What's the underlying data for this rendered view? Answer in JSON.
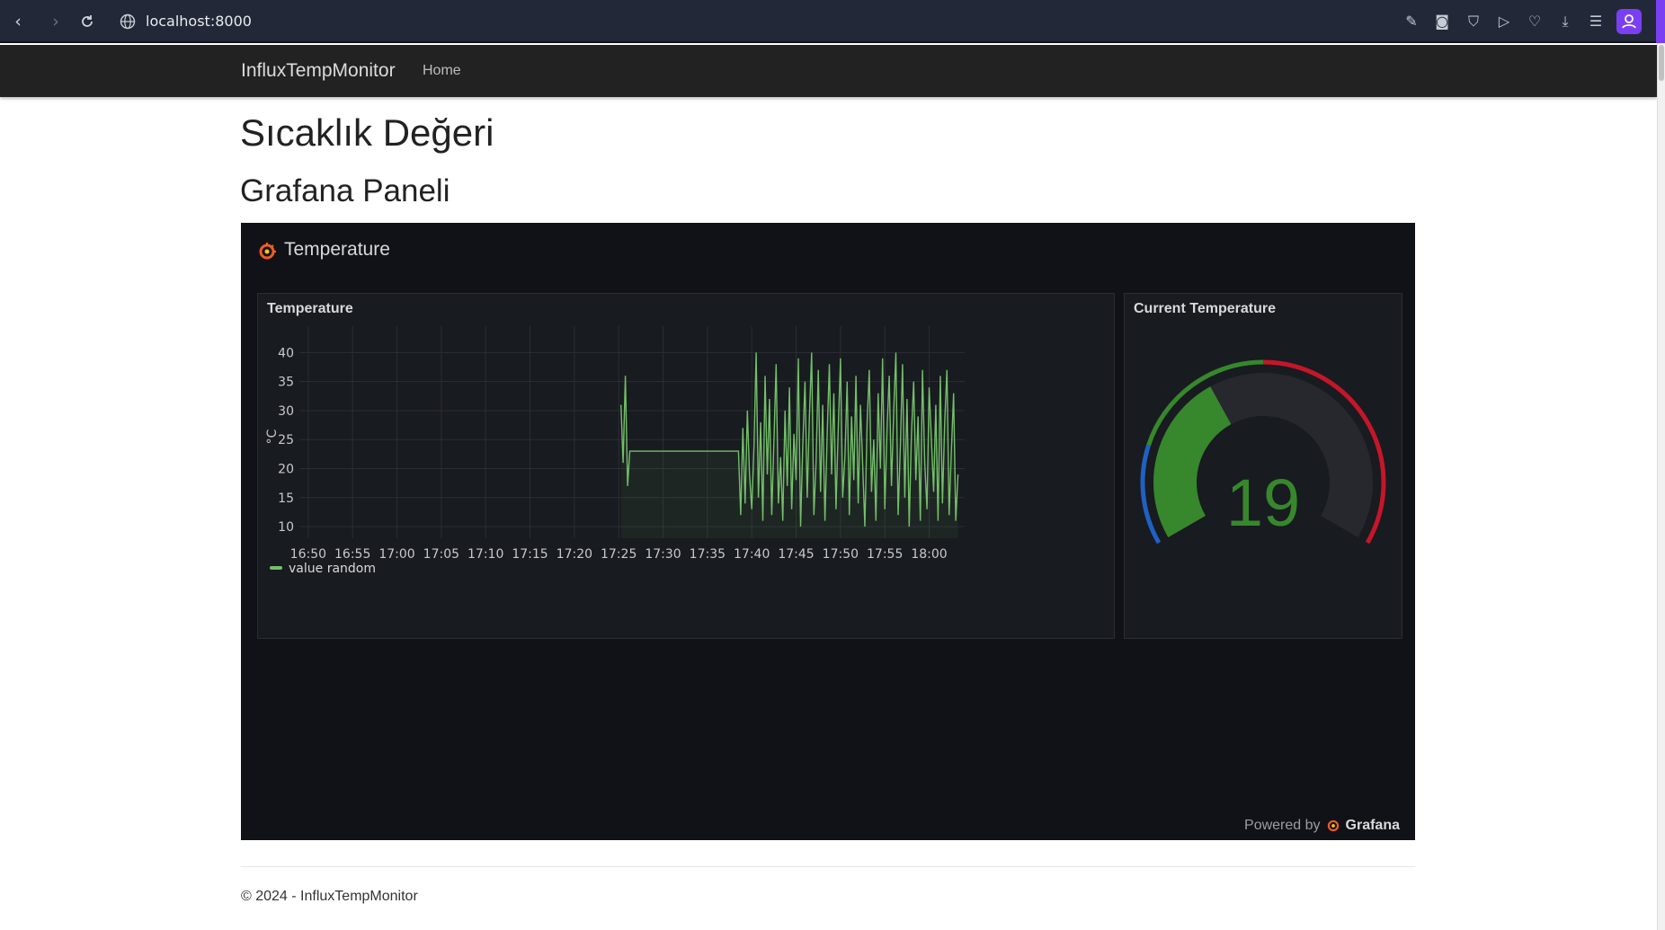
{
  "browser": {
    "url": "localhost:8000",
    "back_icon": "chevron-left-icon",
    "forward_icon": "chevron-right-icon",
    "reload_icon": "reload-icon"
  },
  "navbar": {
    "brand": "InfluxTempMonitor",
    "links": [
      "Home"
    ]
  },
  "page": {
    "title": "Sıcaklık Değeri",
    "subtitle": "Grafana Paneli"
  },
  "dashboard": {
    "title": "Temperature",
    "powered_by": "Powered by",
    "grafana_name": "Grafana",
    "panels": {
      "timeseries": {
        "title": "Temperature",
        "legend": "value random",
        "y_unit_label": "°C"
      },
      "gauge": {
        "title": "Current Temperature",
        "value": "19"
      }
    }
  },
  "colors": {
    "series": "#73bf69",
    "gauge_green": "#37872d",
    "gauge_blue": "#1f60c4",
    "gauge_red": "#c4162a",
    "panel_bg": "#181b1f",
    "dash_bg": "#111217"
  },
  "footer": {
    "text": "© 2024 - InfluxTempMonitor"
  },
  "chart_data": {
    "type": "line",
    "title": "Temperature",
    "ylabel": "°C",
    "ylim": [
      8,
      43
    ],
    "yticks": [
      "10",
      "15",
      "20",
      "25",
      "30",
      "35",
      "40"
    ],
    "xticks": [
      "16:50",
      "16:55",
      "17:00",
      "17:05",
      "17:10",
      "17:15",
      "17:20",
      "17:25",
      "17:30",
      "17:35",
      "17:40",
      "17:45",
      "17:50",
      "17:55",
      "18:00"
    ],
    "series": [
      {
        "name": "value random",
        "points": [
          [
            "17:25:15",
            31
          ],
          [
            "17:25:30",
            21
          ],
          [
            "17:25:45",
            36
          ],
          [
            "17:26:00",
            17
          ],
          [
            "17:26:15",
            23
          ],
          [
            "17:38:30",
            23
          ],
          [
            "17:38:45",
            12
          ],
          [
            "17:39:00",
            27
          ],
          [
            "17:39:15",
            14
          ],
          [
            "17:39:30",
            30
          ],
          [
            "17:39:45",
            19
          ],
          [
            "17:40:00",
            13
          ],
          [
            "17:40:15",
            24
          ],
          [
            "17:40:30",
            40
          ],
          [
            "17:40:45",
            15
          ],
          [
            "17:41:00",
            28
          ],
          [
            "17:41:15",
            11
          ],
          [
            "17:41:30",
            36
          ],
          [
            "17:41:45",
            19
          ],
          [
            "17:42:00",
            32
          ],
          [
            "17:42:15",
            12
          ],
          [
            "17:42:30",
            25
          ],
          [
            "17:42:45",
            38
          ],
          [
            "17:43:00",
            14
          ],
          [
            "17:43:15",
            22
          ],
          [
            "17:43:30",
            11
          ],
          [
            "17:43:45",
            30
          ],
          [
            "17:44:00",
            17
          ],
          [
            "17:44:15",
            34
          ],
          [
            "17:44:30",
            13
          ],
          [
            "17:44:45",
            26
          ],
          [
            "17:45:00",
            18
          ],
          [
            "17:45:15",
            39
          ],
          [
            "17:45:30",
            10
          ],
          [
            "17:45:45",
            24
          ],
          [
            "17:46:00",
            35
          ],
          [
            "17:46:15",
            15
          ],
          [
            "17:46:30",
            29
          ],
          [
            "17:46:45",
            40
          ],
          [
            "17:47:00",
            12
          ],
          [
            "17:47:15",
            21
          ],
          [
            "17:47:30",
            37
          ],
          [
            "17:47:45",
            16
          ],
          [
            "17:48:00",
            31
          ],
          [
            "17:48:15",
            11
          ],
          [
            "17:48:30",
            26
          ],
          [
            "17:48:45",
            38
          ],
          [
            "17:49:00",
            19
          ],
          [
            "17:49:15",
            33
          ],
          [
            "17:49:30",
            13
          ],
          [
            "17:49:45",
            27
          ],
          [
            "17:50:00",
            39
          ],
          [
            "17:50:15",
            15
          ],
          [
            "17:50:30",
            22
          ],
          [
            "17:50:45",
            35
          ],
          [
            "17:51:00",
            12
          ],
          [
            "17:51:15",
            29
          ],
          [
            "17:51:30",
            18
          ],
          [
            "17:51:45",
            36
          ],
          [
            "17:52:00",
            14
          ],
          [
            "17:52:15",
            31
          ],
          [
            "17:52:30",
            21
          ],
          [
            "17:52:45",
            10
          ],
          [
            "17:53:00",
            28
          ],
          [
            "17:53:15",
            37
          ],
          [
            "17:53:30",
            16
          ],
          [
            "17:53:45",
            25
          ],
          [
            "17:54:00",
            11
          ],
          [
            "17:54:15",
            33
          ],
          [
            "17:54:30",
            20
          ],
          [
            "17:54:45",
            39
          ],
          [
            "17:55:00",
            13
          ],
          [
            "17:55:15",
            27
          ],
          [
            "17:55:30",
            36
          ],
          [
            "17:55:45",
            17
          ],
          [
            "17:56:00",
            30
          ],
          [
            "17:56:15",
            40
          ],
          [
            "17:56:30",
            12
          ],
          [
            "17:56:45",
            24
          ],
          [
            "17:57:00",
            38
          ],
          [
            "17:57:15",
            15
          ],
          [
            "17:57:30",
            32
          ],
          [
            "17:57:45",
            10
          ],
          [
            "17:58:00",
            26
          ],
          [
            "17:58:15",
            35
          ],
          [
            "17:58:30",
            18
          ],
          [
            "17:58:45",
            29
          ],
          [
            "17:59:00",
            11
          ],
          [
            "17:59:15",
            37
          ],
          [
            "17:59:30",
            21
          ],
          [
            "17:59:45",
            13
          ],
          [
            "18:00:00",
            34
          ],
          [
            "18:00:15",
            25
          ],
          [
            "18:00:30",
            16
          ],
          [
            "18:00:45",
            31
          ],
          [
            "18:01:00",
            11
          ],
          [
            "18:01:15",
            36
          ],
          [
            "18:01:30",
            14
          ],
          [
            "18:01:45",
            28
          ],
          [
            "18:02:00",
            37
          ],
          [
            "18:02:15",
            12
          ],
          [
            "18:02:30",
            23
          ],
          [
            "18:02:45",
            33
          ],
          [
            "18:03:00",
            11
          ],
          [
            "18:03:15",
            19
          ]
        ]
      }
    ],
    "gauge": {
      "value": 19,
      "min": 0,
      "max": 50,
      "thresholds": [
        {
          "color": "#1f60c4",
          "from": 0,
          "to": 10
        },
        {
          "color": "#37872d",
          "from": 10,
          "to": 25
        },
        {
          "color": "#c4162a",
          "from": 25,
          "to": 50
        }
      ]
    }
  }
}
